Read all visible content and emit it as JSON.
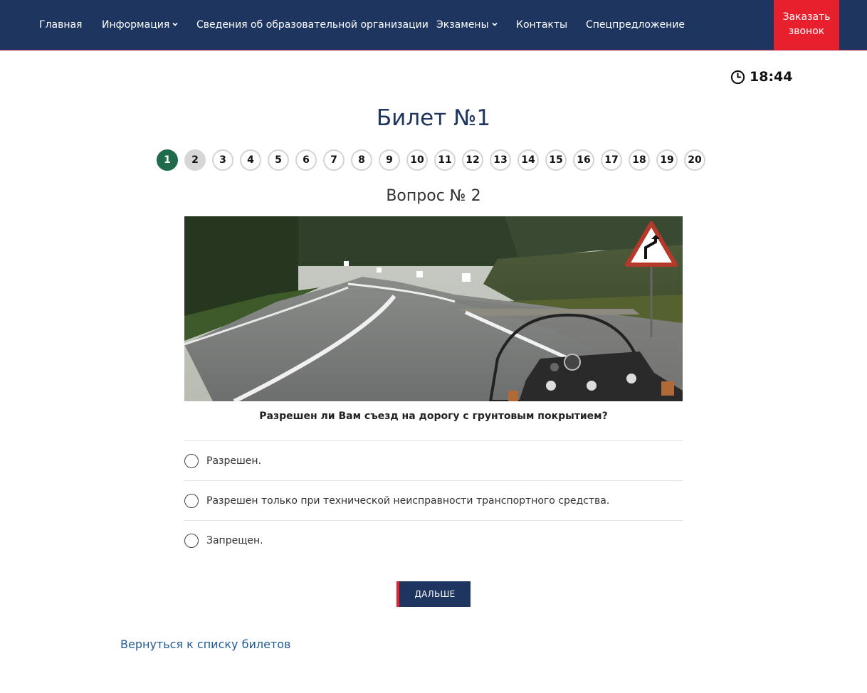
{
  "nav": {
    "items": [
      {
        "label": "Главная",
        "has_dropdown": false
      },
      {
        "label": "Информация",
        "has_dropdown": true
      },
      {
        "label": "Сведения об образовательной организации",
        "has_dropdown": false
      },
      {
        "label": "Экзамены",
        "has_dropdown": true
      },
      {
        "label": "Контакты",
        "has_dropdown": false
      },
      {
        "label": "Спецпредложение",
        "has_dropdown": false
      }
    ],
    "call_button_line1": "Заказать",
    "call_button_line2": "звонок"
  },
  "timer": {
    "value": "18:44",
    "icon": "clock-icon"
  },
  "ticket": {
    "title": "Билет №1",
    "questions": [
      "1",
      "2",
      "3",
      "4",
      "5",
      "6",
      "7",
      "8",
      "9",
      "10",
      "11",
      "12",
      "13",
      "14",
      "15",
      "16",
      "17",
      "18",
      "19",
      "20"
    ],
    "answered": [
      "1"
    ],
    "current": "2"
  },
  "question": {
    "title": "Вопрос № 2",
    "text": "Разрешен ли Вам съезд на дорогу с грунтовым покрытием?",
    "answers": [
      "Разрешен.",
      "Разрешен только при технической неисправности транспортного средства.",
      "Запрещен."
    ]
  },
  "actions": {
    "next_label": "ДАЛЬШЕ",
    "back_link": "Вернуться к списку билетов"
  },
  "colors": {
    "nav_bg": "#1e3560",
    "accent_red": "#e8202e",
    "answered_green": "#1f6b4a",
    "link_blue": "#1f5a96"
  }
}
